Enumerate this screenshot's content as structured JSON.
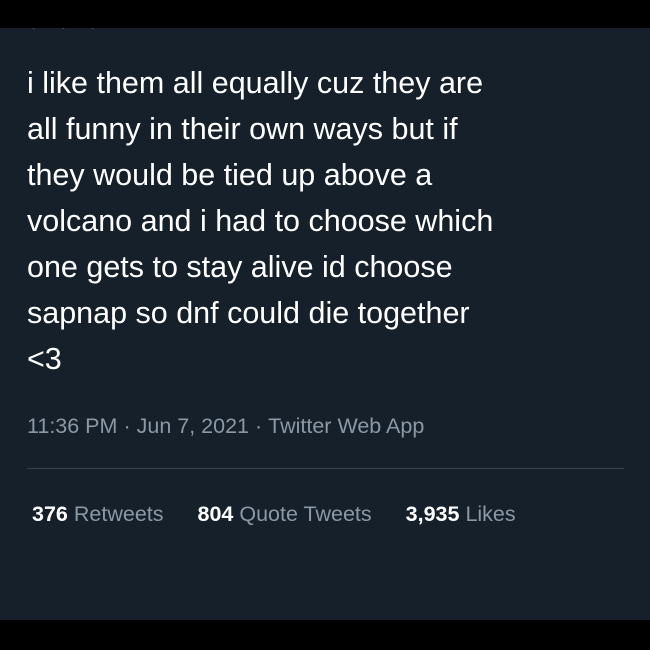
{
  "tweet": {
    "text": "i like them all equally cuz they are\nall funny in their own ways but if\nthey would be tied up above a\nvolcano and i had to choose which\none gets to stay alive id choose\nsapnap so dnf could die together\n<3",
    "time": "11:36 PM",
    "date": "Jun 7, 2021",
    "source": "Twitter Web App",
    "separator": "·"
  },
  "stats": {
    "retweets": {
      "count": "376",
      "label": "Retweets"
    },
    "quotes": {
      "count": "804",
      "label": "Quote Tweets"
    },
    "likes": {
      "count": "3,935",
      "label": "Likes"
    }
  },
  "colors": {
    "background": "#15202b",
    "text": "#ffffff",
    "secondary_text": "#8b98a5",
    "divider": "#38444d"
  }
}
